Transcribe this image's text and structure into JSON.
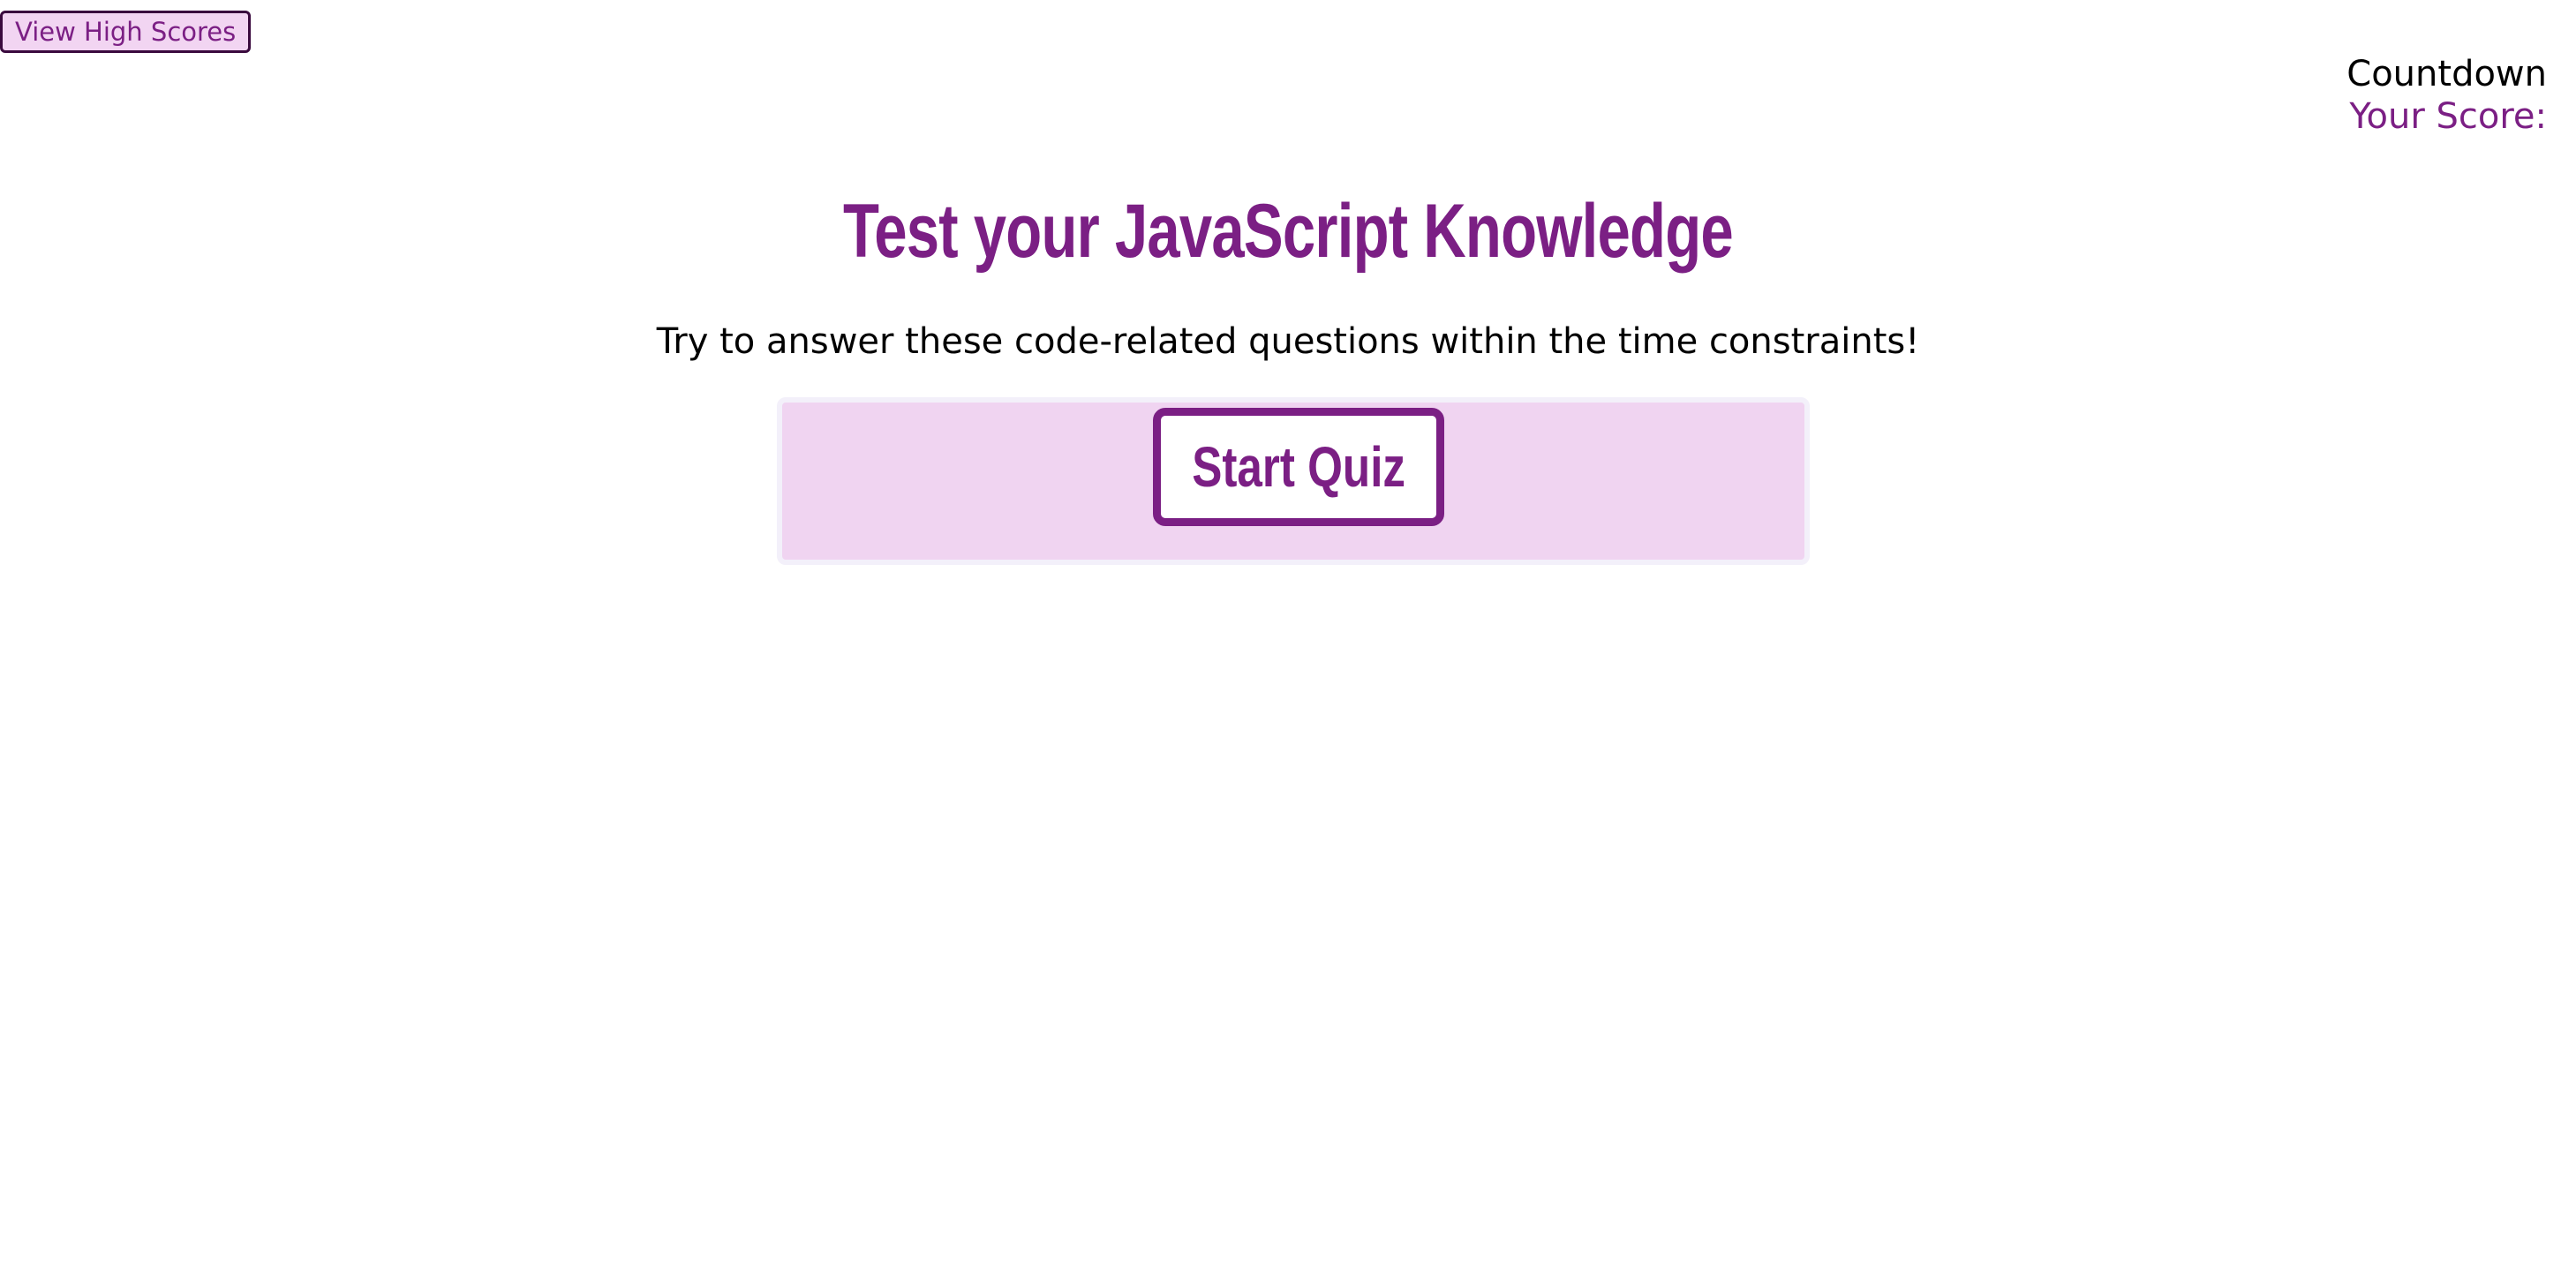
{
  "header": {
    "high_scores_label": "View High Scores",
    "countdown_label": "Countdown",
    "score_label": "Your Score:"
  },
  "main": {
    "title": "Test your JavaScript Knowledge",
    "subtitle": "Try to answer these code-related questions within the time constraints!",
    "start_button_label": "Start Quiz"
  },
  "colors": {
    "accent": "#7b1f84",
    "panel_background": "#f0d4f1",
    "button_light": "#f2d5f2"
  }
}
